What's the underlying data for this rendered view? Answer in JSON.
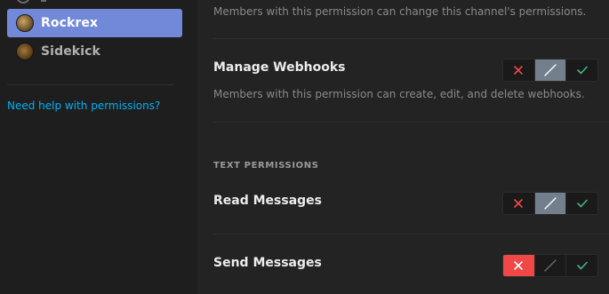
{
  "sidebar": {
    "roles": [
      {
        "label": "Rockrex",
        "active": true
      },
      {
        "label": "Sidekick",
        "active": false
      }
    ],
    "help_link": "Need help with permissions?"
  },
  "permissions": {
    "manage_permissions_desc": "Members with this permission can change this channel's permissions.",
    "manage_webhooks": {
      "title": "Manage Webhooks",
      "desc": "Members with this permission can create, edit, and delete webhooks.",
      "state": "passthrough"
    },
    "text_section_title": "TEXT PERMISSIONS",
    "read_messages": {
      "title": "Read Messages",
      "state": "passthrough"
    },
    "send_messages": {
      "title": "Send Messages",
      "state": "deny"
    }
  },
  "colors": {
    "accent": "#7289da",
    "deny": "#f04747",
    "allow": "#43b581",
    "passthrough": "#737f8d",
    "link": "#00b0f4"
  },
  "icons": {
    "deny": "x-icon",
    "passthrough": "slash-icon",
    "allow": "check-icon"
  }
}
